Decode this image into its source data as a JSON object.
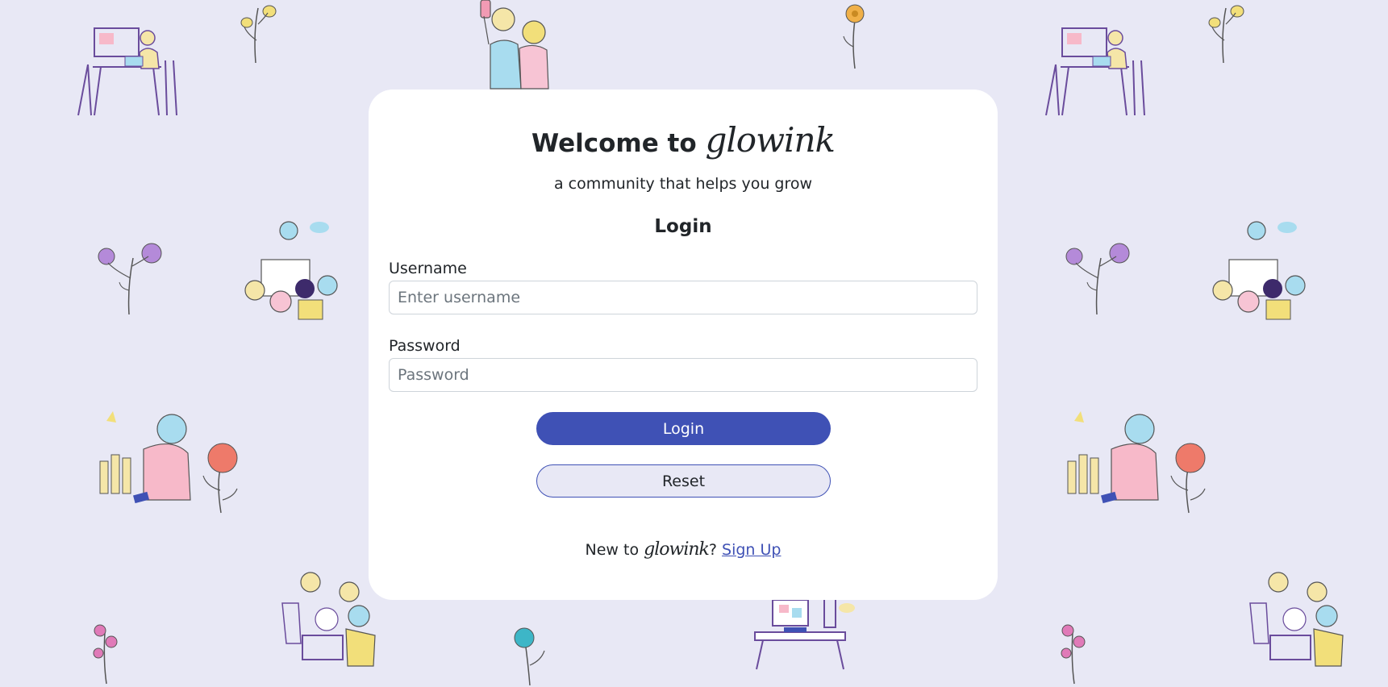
{
  "header": {
    "welcome_prefix": "Welcome to ",
    "brand": "glowink",
    "tagline": "a community that helps you grow"
  },
  "form": {
    "heading": "Login",
    "username": {
      "label": "Username",
      "value": "",
      "placeholder": "Enter username"
    },
    "password": {
      "label": "Password",
      "value": "",
      "placeholder": "Password"
    },
    "login_button": "Login",
    "reset_button": "Reset"
  },
  "footer": {
    "prefix": "New to ",
    "brand": "glowink",
    "question_mark": "?",
    "signup_link": "Sign Up"
  },
  "colors": {
    "background": "#e8e8f5",
    "card": "#ffffff",
    "accent": "#3f51b5"
  },
  "background_illustrations": [
    "streamer-desk-illustration",
    "yellow-flower-illustration",
    "selfie-couple-illustration",
    "orange-flower-illustration",
    "purple-flower-illustration",
    "speaker-audience-illustration",
    "coins-person-illustration",
    "red-rose-illustration",
    "pink-flower-illustration",
    "team-laptop-illustration",
    "teal-flower-illustration",
    "desk-computer-illustration"
  ]
}
